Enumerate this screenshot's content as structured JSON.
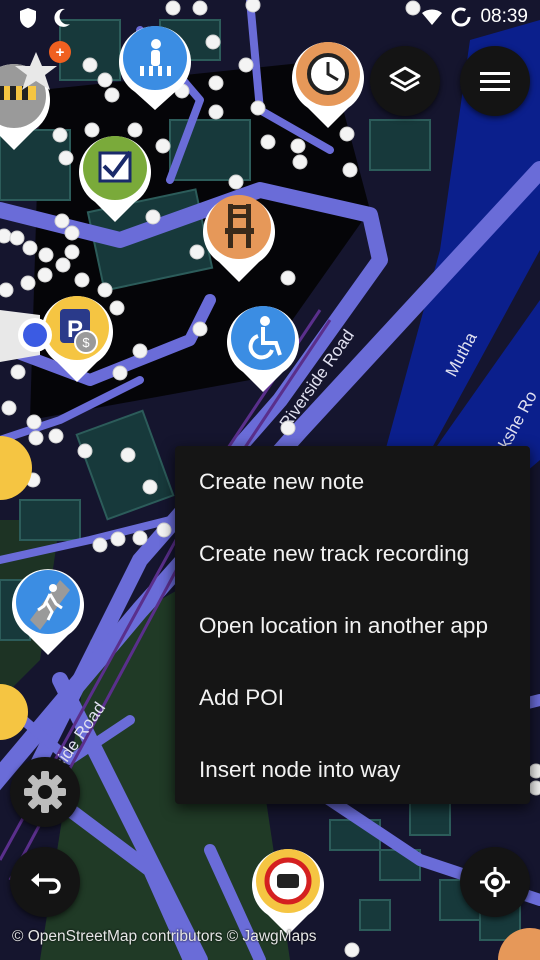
{
  "status_bar": {
    "time": "08:39",
    "icons": [
      "shield-icon",
      "moon-icon",
      "wifi-icon",
      "sync-icon"
    ]
  },
  "map": {
    "road_labels": [
      "Riverside Road",
      "side Road",
      "Mutha",
      "kshe Ro"
    ],
    "poi_markers": [
      "pedestrian-crossing-icon",
      "clock-icon",
      "checkbox-icon",
      "chair-icon",
      "parking-paid-icon",
      "wheelchair-icon",
      "pedestrian-icon",
      "no-cars-icon",
      "barrier-icon"
    ],
    "colors": {
      "background": "#14142a",
      "roads": "#6a6cd8",
      "water": "#0b1f8c",
      "buildings": "#17383a",
      "park": "#203a26"
    }
  },
  "context_menu": {
    "items": [
      "Create new note",
      "Create new track recording",
      "Open location in another app",
      "Add POI",
      "Insert node into way"
    ]
  },
  "buttons": {
    "layers": "layers-icon",
    "menu": "hamburger-menu-icon",
    "settings": "gear-icon",
    "undo": "undo-icon",
    "locate": "gps-locate-icon"
  },
  "attribution": "© OpenStreetMap contributors  © JawgMaps"
}
